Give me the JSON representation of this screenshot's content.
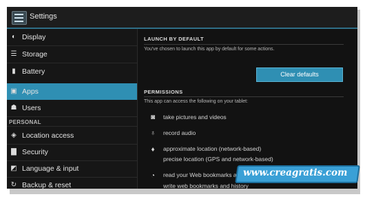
{
  "window": {
    "title": "Settings"
  },
  "sidebar": {
    "items": [
      {
        "label": "Display",
        "icon": "display-icon"
      },
      {
        "label": "Storage",
        "icon": "storage-icon"
      },
      {
        "label": "Battery",
        "icon": "battery-icon"
      },
      {
        "label": "Apps",
        "icon": "apps-icon",
        "selected": true
      },
      {
        "label": "Users",
        "icon": "users-icon"
      }
    ],
    "personal_header": "PERSONAL",
    "personal_items": [
      {
        "label": "Location access",
        "icon": "location-icon"
      },
      {
        "label": "Security",
        "icon": "lock-icon"
      },
      {
        "label": "Language & input",
        "icon": "language-icon"
      },
      {
        "label": "Backup & reset",
        "icon": "backup-icon"
      }
    ]
  },
  "launch": {
    "header": "LAUNCH BY DEFAULT",
    "description": "You've chosen to launch this app by default for some actions.",
    "button": "Clear defaults"
  },
  "permissions": {
    "header": "PERMISSIONS",
    "description": "This app can access the following on your tablet:",
    "items": [
      {
        "icon": "camera-icon",
        "text": "take pictures and videos"
      },
      {
        "icon": "microphone-icon",
        "text": "record audio"
      },
      {
        "icon": "location-pin-icon",
        "text": "approximate location (network-based)"
      },
      {
        "icon": "",
        "text": "precise location (GPS and network-based)"
      },
      {
        "icon": "bookmark-history-icon",
        "text": "read your Web bookmarks and h"
      },
      {
        "icon": "",
        "text": "write web bookmarks and history"
      }
    ]
  },
  "watermark": {
    "text": "www.creagratis.com"
  },
  "colors": {
    "accent": "#2f8fb3",
    "background": "#141414"
  }
}
